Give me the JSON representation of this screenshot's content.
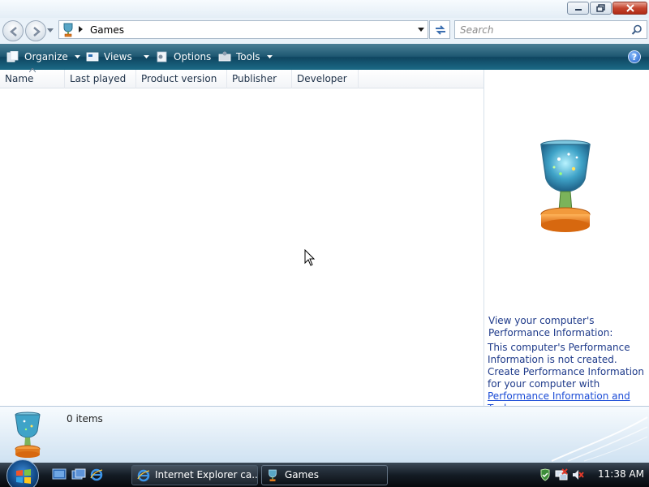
{
  "address": {
    "breadcrumb": "Games"
  },
  "search": {
    "placeholder": "Search"
  },
  "toolbar": {
    "organize": "Organize",
    "views": "Views",
    "options": "Options",
    "tools": "Tools",
    "help": "?"
  },
  "columns": [
    "Name",
    "Last played",
    "Product version",
    "Publisher",
    "Developer"
  ],
  "details": {
    "title": "View your computer's Performance Information:",
    "body1": "This computer's Performance Information is not created.",
    "body2": "Create Performance Information for your computer with ",
    "link": "Performance Information and Tools",
    "body_end": "."
  },
  "status": {
    "items": "0 items"
  },
  "taskbar": {
    "tasks": [
      "Internet Explorer ca...",
      "Games"
    ],
    "clock": "11:38 AM"
  }
}
